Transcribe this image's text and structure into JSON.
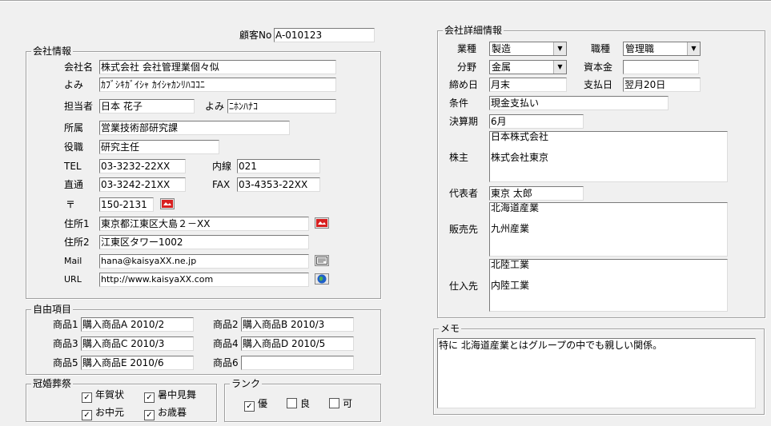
{
  "customer_no": {
    "label": "顧客No",
    "value": "A-010123"
  },
  "company": {
    "frame_title": "会社情報",
    "name": {
      "label": "会社名",
      "value": "株式会社 会社管理業個々似"
    },
    "kana": {
      "label": "よみ",
      "value": "ｶﾌﾞｼｷｶﾞｲｼｬ ｶｲｼｬｶﾝﾘﾊｺｺﾆ"
    },
    "person": {
      "label": "担当者",
      "value": "日本 花子"
    },
    "person_kana": {
      "label": "よみ",
      "value": "ﾆﾎﾝﾊﾅｺ"
    },
    "dept": {
      "label": "所属",
      "value": "営業技術部研究課"
    },
    "title": {
      "label": "役職",
      "value": "研究主任"
    },
    "tel": {
      "label": "TEL",
      "value": "03-3232-22XX"
    },
    "ext": {
      "label": "内線",
      "value": "021"
    },
    "direct": {
      "label": "直通",
      "value": "03-3242-21XX"
    },
    "fax": {
      "label": "FAX",
      "value": "03-4353-22XX"
    },
    "zip": {
      "label": "〒",
      "value": "150-2131"
    },
    "addr1": {
      "label": "住所1",
      "value": "東京都江東区大島２－XX"
    },
    "addr2": {
      "label": "住所2",
      "value": "江東区タワー1002"
    },
    "mail": {
      "label": "Mail",
      "value": "hana@kaisyaXX.ne.jp"
    },
    "url": {
      "label": "URL",
      "value": "http://www.kaisyaXX.com"
    }
  },
  "free": {
    "frame_title": "自由項目",
    "items": [
      {
        "label": "商品1",
        "value": "購入商品A  2010/2"
      },
      {
        "label": "商品2",
        "value": "購入商品B  2010/3"
      },
      {
        "label": "商品3",
        "value": "購入商品C  2010/3"
      },
      {
        "label": "商品4",
        "value": "購入商品D  2010/5"
      },
      {
        "label": "商品5",
        "value": "購入商品E  2010/6"
      },
      {
        "label": "商品6",
        "value": ""
      }
    ]
  },
  "ceremony": {
    "frame_title": "冠婚葬祭",
    "items": [
      {
        "label": "年賀状",
        "checked": true
      },
      {
        "label": "暑中見舞",
        "checked": true
      },
      {
        "label": "お中元",
        "checked": true
      },
      {
        "label": "お歳暮",
        "checked": true
      }
    ]
  },
  "rank": {
    "frame_title": "ランク",
    "items": [
      {
        "label": "優",
        "checked": true
      },
      {
        "label": "良",
        "checked": false
      },
      {
        "label": "可",
        "checked": false
      }
    ]
  },
  "detail": {
    "frame_title": "会社詳細情報",
    "industry": {
      "label": "業種",
      "value": "製造"
    },
    "job": {
      "label": "職種",
      "value": "管理職"
    },
    "field": {
      "label": "分野",
      "value": "金属"
    },
    "capital": {
      "label": "資本金",
      "value": ""
    },
    "closing": {
      "label": "締め日",
      "value": "月末"
    },
    "payday": {
      "label": "支払日",
      "value": "翌月20日"
    },
    "terms": {
      "label": "条件",
      "value": "現金支払い"
    },
    "fiscal": {
      "label": "決算期",
      "value": "6月"
    },
    "shareholders": {
      "label": "株主",
      "value": "日本株式会社\n\n株式会社東京"
    },
    "rep": {
      "label": "代表者",
      "value": "東京 太郎"
    },
    "sales": {
      "label": "販売先",
      "value": "北海道産業\n\n九州産業"
    },
    "suppliers": {
      "label": "仕入先",
      "value": "北陸工業\n\n内陸工業"
    }
  },
  "memo": {
    "frame_title": "メモ",
    "value": "特に 北海道産業とはグループの中でも親しい関係。"
  },
  "icons": {
    "map": "map-icon",
    "mail": "mail-icon",
    "web": "globe-icon",
    "check": "✓"
  }
}
